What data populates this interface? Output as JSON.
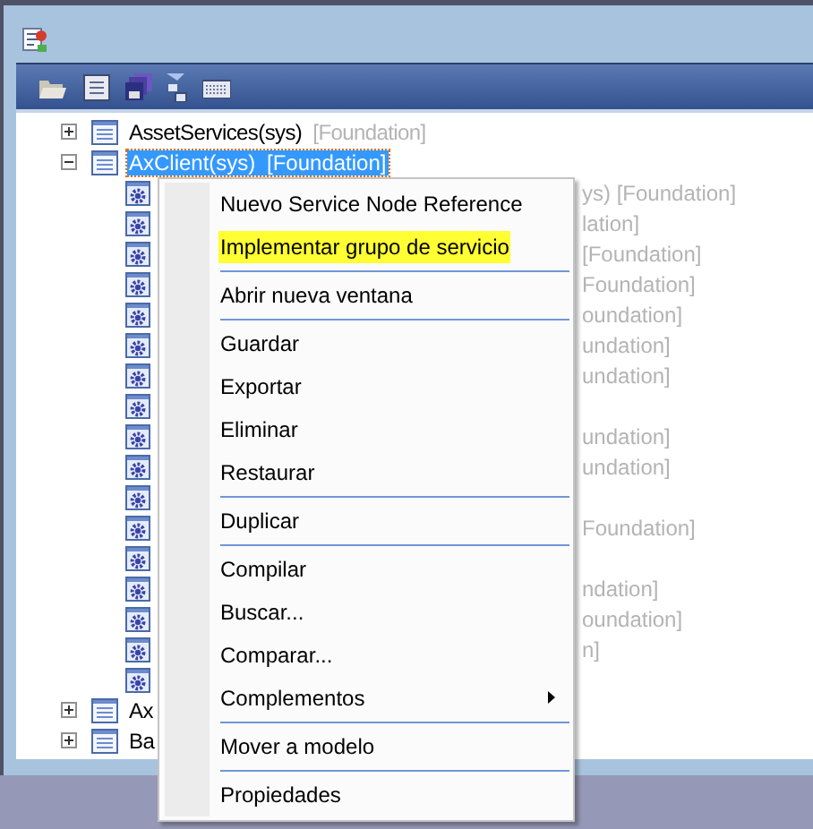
{
  "tree": {
    "items": [
      {
        "label": "AssetServices(sys)",
        "layer": "[Foundation]",
        "expanded": false,
        "selected": false
      },
      {
        "label": "AxClient(sys)",
        "layer": "[Foundation]",
        "expanded": true,
        "selected": true,
        "children": [
          {
            "kind": "service",
            "label": "ys)  [Foundation]"
          },
          {
            "kind": "service",
            "label": "lation]"
          },
          {
            "kind": "service",
            "label": "[Foundation]"
          },
          {
            "kind": "service",
            "label": "Foundation]"
          },
          {
            "kind": "service",
            "label": "oundation]"
          },
          {
            "kind": "service",
            "label": "undation]"
          },
          {
            "kind": "service",
            "label": "undation]"
          },
          {
            "kind": "service"
          },
          {
            "kind": "service",
            "label": "undation]"
          },
          {
            "kind": "service",
            "label": "undation]"
          },
          {
            "kind": "service"
          },
          {
            "kind": "service",
            "label": "Foundation]"
          },
          {
            "kind": "service"
          },
          {
            "kind": "service",
            "label": "ndation]"
          },
          {
            "kind": "service",
            "label": "oundation]"
          },
          {
            "kind": "service",
            "label": "n]"
          },
          {
            "kind": "service"
          }
        ]
      },
      {
        "label": "Ax",
        "expanded": false,
        "selected": false
      },
      {
        "label": "Ba",
        "expanded": false,
        "selected": false
      }
    ]
  },
  "context_menu": {
    "items": [
      {
        "kind": "item",
        "label": "Nuevo Service Node Reference",
        "highlighted": false
      },
      {
        "kind": "item",
        "label": "Implementar grupo de servicio",
        "highlighted": true
      },
      {
        "kind": "separator"
      },
      {
        "kind": "item",
        "label": "Abrir nueva ventana",
        "highlighted": false
      },
      {
        "kind": "separator"
      },
      {
        "kind": "item",
        "label": "Guardar",
        "highlighted": false
      },
      {
        "kind": "item",
        "label": "Exportar",
        "highlighted": false
      },
      {
        "kind": "item",
        "label": "Eliminar",
        "highlighted": false
      },
      {
        "kind": "item",
        "label": "Restaurar",
        "highlighted": false
      },
      {
        "kind": "separator"
      },
      {
        "kind": "item",
        "label": "Duplicar",
        "highlighted": false
      },
      {
        "kind": "separator"
      },
      {
        "kind": "item",
        "label": "Compilar",
        "highlighted": false
      },
      {
        "kind": "item",
        "label": "Buscar...",
        "highlighted": false
      },
      {
        "kind": "item",
        "label": "Comparar...",
        "highlighted": false
      },
      {
        "kind": "item",
        "label": "Complementos",
        "highlighted": false,
        "submenu": true
      },
      {
        "kind": "separator"
      },
      {
        "kind": "item",
        "label": "Mover a modelo",
        "highlighted": false
      },
      {
        "kind": "separator"
      },
      {
        "kind": "item",
        "label": "Propiedades",
        "highlighted": false
      }
    ]
  }
}
